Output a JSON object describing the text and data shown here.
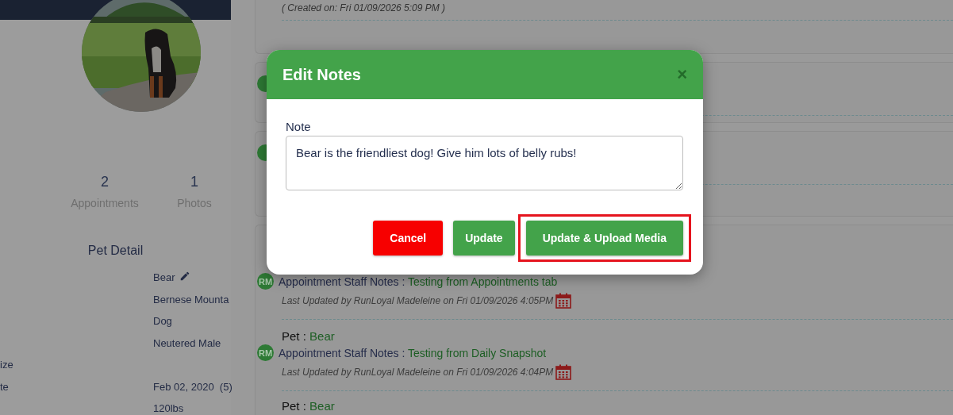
{
  "pet_profile": {
    "stats": [
      {
        "value": "2",
        "label": "Appointments"
      },
      {
        "value": "1",
        "label": "Photos"
      }
    ],
    "section_title": "Pet Detail",
    "details": [
      {
        "value": "Bear",
        "editable": true
      },
      {
        "value": "Bernese Mounta",
        "editable": false
      },
      {
        "value": "Dog",
        "editable": false
      },
      {
        "value": "Neutered Male",
        "editable": false
      },
      {
        "label": "ize",
        "editable": false
      },
      {
        "label": "te",
        "value": "Feb 02, 2020  (5)",
        "editable": false
      },
      {
        "value": "120lbs",
        "editable": false
      }
    ]
  },
  "notes_cards": [
    {
      "entries": [
        {
          "kind": "created",
          "text": "( Created on: Fri 01/09/2026 5:09 PM )"
        }
      ]
    },
    {
      "entries": [
        {
          "kind": "avatar"
        }
      ]
    },
    {
      "entries": [
        {
          "kind": "avatar"
        }
      ]
    },
    {
      "entries": [
        {
          "kind": "note",
          "avatar": "RM",
          "note_label": "Appointment Staff Notes :",
          "note": "Testing from Appointments tab",
          "updated": "Last Updated by RunLoyal Madeleine on Fri 01/09/2026 4:05PM"
        },
        {
          "kind": "note",
          "pet_label": "Pet :",
          "pet": "Bear",
          "avatar": "RM",
          "note_label": "Appointment Staff Notes :",
          "note": "Testing from Daily Snapshot",
          "updated": "Last Updated by RunLoyal Madeleine on Fri 01/09/2026 4:04PM"
        },
        {
          "kind": "pet",
          "pet_label": "Pet :",
          "pet": "Bear"
        }
      ]
    }
  ],
  "modal": {
    "title": "Edit Notes",
    "close": "×",
    "field_label": "Note",
    "value": "Bear is the friendliest dog! Give him lots of belly rubs!",
    "buttons": [
      {
        "label": "Cancel",
        "kind": "danger",
        "highlighted": false
      },
      {
        "label": "Update",
        "kind": "primary",
        "highlighted": false
      },
      {
        "label": "Update & Upload Media",
        "kind": "primary",
        "highlighted": true
      }
    ]
  }
}
